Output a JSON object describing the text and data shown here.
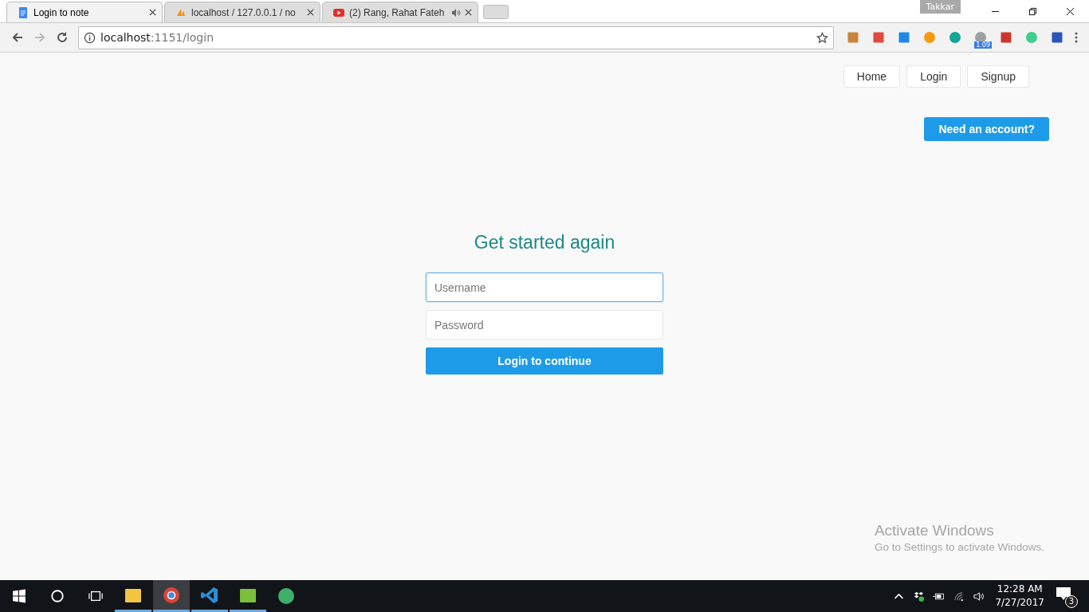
{
  "browser": {
    "tabs": [
      {
        "title": "Login to note",
        "kind": "doc",
        "selected": true,
        "audio": false
      },
      {
        "title": "localhost / 127.0.0.1 / no",
        "kind": "pma",
        "selected": false,
        "audio": false
      },
      {
        "title": "(2) Rang, Rahat Fateh",
        "kind": "youtube",
        "selected": false,
        "audio": true
      }
    ],
    "profile": "Takkar",
    "address": {
      "host": "localhost",
      "path": ":1151/login"
    },
    "extensions": [
      {
        "kind": "ruler"
      },
      {
        "kind": "calendar"
      },
      {
        "kind": "download"
      },
      {
        "kind": "s-logo"
      },
      {
        "kind": "m-circle"
      },
      {
        "kind": "gauge",
        "badge": "1.09"
      },
      {
        "kind": "bug"
      },
      {
        "kind": "target"
      },
      {
        "kind": "bookmark"
      }
    ]
  },
  "page": {
    "nav": [
      "Home",
      "Login",
      "Signup"
    ],
    "cta": "Need an account?",
    "heading": "Get started again",
    "fields": [
      {
        "placeholder": "Username",
        "focused": true
      },
      {
        "placeholder": "Password",
        "focused": false
      }
    ],
    "submit": "Login to continue",
    "activation": {
      "title": "Activate Windows",
      "text": "Go to Settings to activate Windows."
    }
  },
  "taskbar": {
    "apps": [
      {
        "kind": "explorer",
        "running": true,
        "active": false
      },
      {
        "kind": "chrome",
        "running": true,
        "active": true
      },
      {
        "kind": "vscode",
        "running": true,
        "active": false
      },
      {
        "kind": "notepad",
        "running": true,
        "active": false
      },
      {
        "kind": "atom",
        "running": false,
        "active": false
      }
    ],
    "time": "12:28 AM",
    "date": "7/27/2017",
    "notifications": "3"
  }
}
